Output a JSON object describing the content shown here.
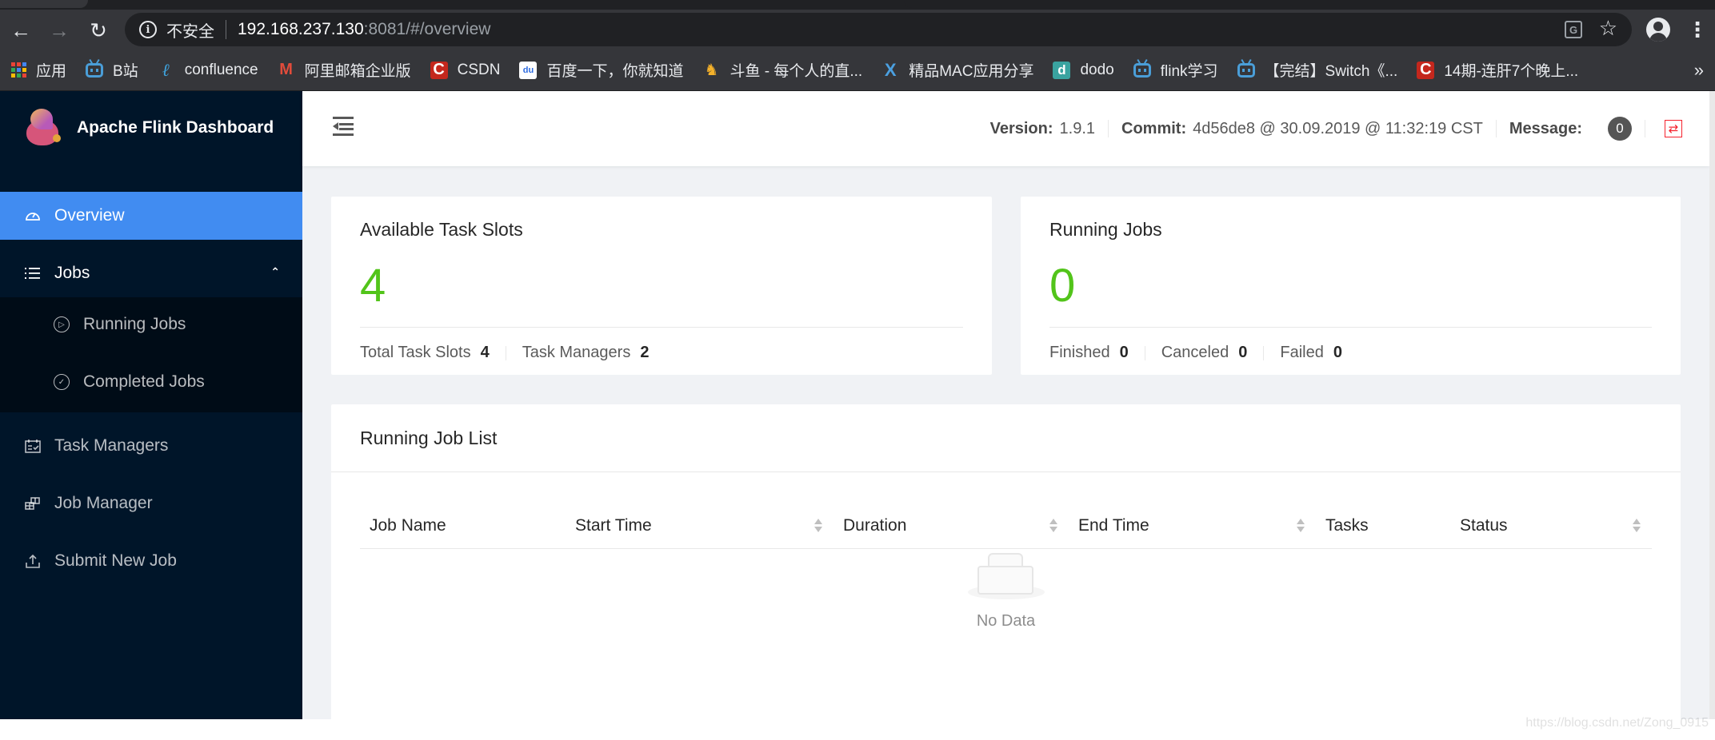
{
  "browser": {
    "security_label": "不安全",
    "url_host": "192.168.237.130",
    "url_rest": ":8081/#/overview",
    "bookmarks": [
      {
        "label": "应用",
        "icon": "apps-grid-icon"
      },
      {
        "label": "B站",
        "icon": "bilibili-icon"
      },
      {
        "label": "confluence",
        "icon": "confluence-icon"
      },
      {
        "label": "阿里邮箱企业版",
        "icon": "aliyun-mail-icon"
      },
      {
        "label": "CSDN",
        "icon": "csdn-icon"
      },
      {
        "label": "百度一下，你就知道",
        "icon": "baidu-icon"
      },
      {
        "label": "斗鱼 - 每个人的直...",
        "icon": "douyu-icon"
      },
      {
        "label": "精品MAC应用分享",
        "icon": "x-icon"
      },
      {
        "label": "dodo",
        "icon": "dodo-icon"
      },
      {
        "label": "flink学习",
        "icon": "bilibili-icon"
      },
      {
        "label": "【完结】Switch《...",
        "icon": "bilibili-icon"
      },
      {
        "label": "14期-连肝7个晚上...",
        "icon": "csdn-icon"
      }
    ],
    "more_bookmarks": "»"
  },
  "app": {
    "title": "Apache Flink Dashboard",
    "sidebar": {
      "items": [
        {
          "label": "Overview",
          "icon": "dashboard-icon",
          "active": true
        },
        {
          "label": "Jobs",
          "icon": "list-icon",
          "expanded": true,
          "children": [
            {
              "label": "Running Jobs",
              "icon": "play-circle-icon"
            },
            {
              "label": "Completed Jobs",
              "icon": "check-circle-icon"
            }
          ]
        },
        {
          "label": "Task Managers",
          "icon": "schedule-icon"
        },
        {
          "label": "Job Manager",
          "icon": "build-icon"
        },
        {
          "label": "Submit New Job",
          "icon": "upload-icon"
        }
      ]
    },
    "header": {
      "version_label": "Version:",
      "version": "1.9.1",
      "commit_label": "Commit:",
      "commit": "4d56de8 @ 30.09.2019 @ 11:32:19 CST",
      "message_label": "Message:",
      "message_count": "0"
    },
    "slots_card": {
      "title": "Available Task Slots",
      "value": "4",
      "total_label": "Total Task Slots",
      "total_value": "4",
      "tm_label": "Task Managers",
      "tm_value": "2"
    },
    "jobs_card": {
      "title": "Running Jobs",
      "value": "0",
      "finished_label": "Finished",
      "finished_value": "0",
      "canceled_label": "Canceled",
      "canceled_value": "0",
      "failed_label": "Failed",
      "failed_value": "0"
    },
    "job_list": {
      "title": "Running Job List",
      "columns": [
        {
          "label": "Job Name",
          "sortable": false
        },
        {
          "label": "Start Time",
          "sortable": true
        },
        {
          "label": "Duration",
          "sortable": true
        },
        {
          "label": "End Time",
          "sortable": true
        },
        {
          "label": "Tasks",
          "sortable": false
        },
        {
          "label": "Status",
          "sortable": true
        }
      ],
      "rows": [],
      "empty_text": "No Data"
    },
    "colors": {
      "sidebar_bg": "#001529",
      "active_item": "#418cf1",
      "stat_green": "#52c41a",
      "refresh_red": "#f5222d"
    }
  },
  "watermark": "https://blog.csdn.net/Zong_0915"
}
